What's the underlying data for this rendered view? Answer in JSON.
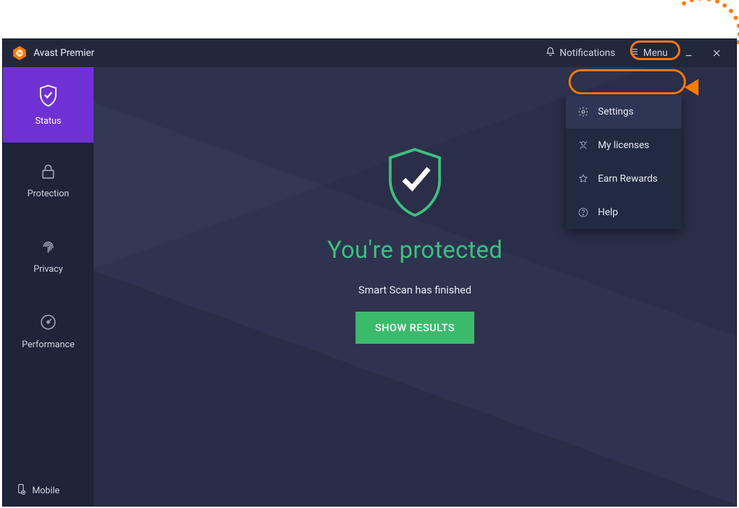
{
  "titlebar": {
    "app_name": "Avast Premier",
    "notifications_label": "Notifications",
    "menu_label": "Menu"
  },
  "sidebar": {
    "status": "Status",
    "protection": "Protection",
    "privacy": "Privacy",
    "performance": "Performance",
    "mobile": "Mobile"
  },
  "main": {
    "headline": "You're protected",
    "subline": "Smart Scan has finished",
    "cta": "SHOW RESULTS"
  },
  "dropdown": {
    "settings": "Settings",
    "licenses": "My licenses",
    "rewards": "Earn Rewards",
    "help": "Help"
  },
  "colors": {
    "accent_purple": "#7031d4",
    "accent_green": "#3cba6b",
    "status_text": "#3fbf7f",
    "annotation_orange": "#ff7a00"
  }
}
